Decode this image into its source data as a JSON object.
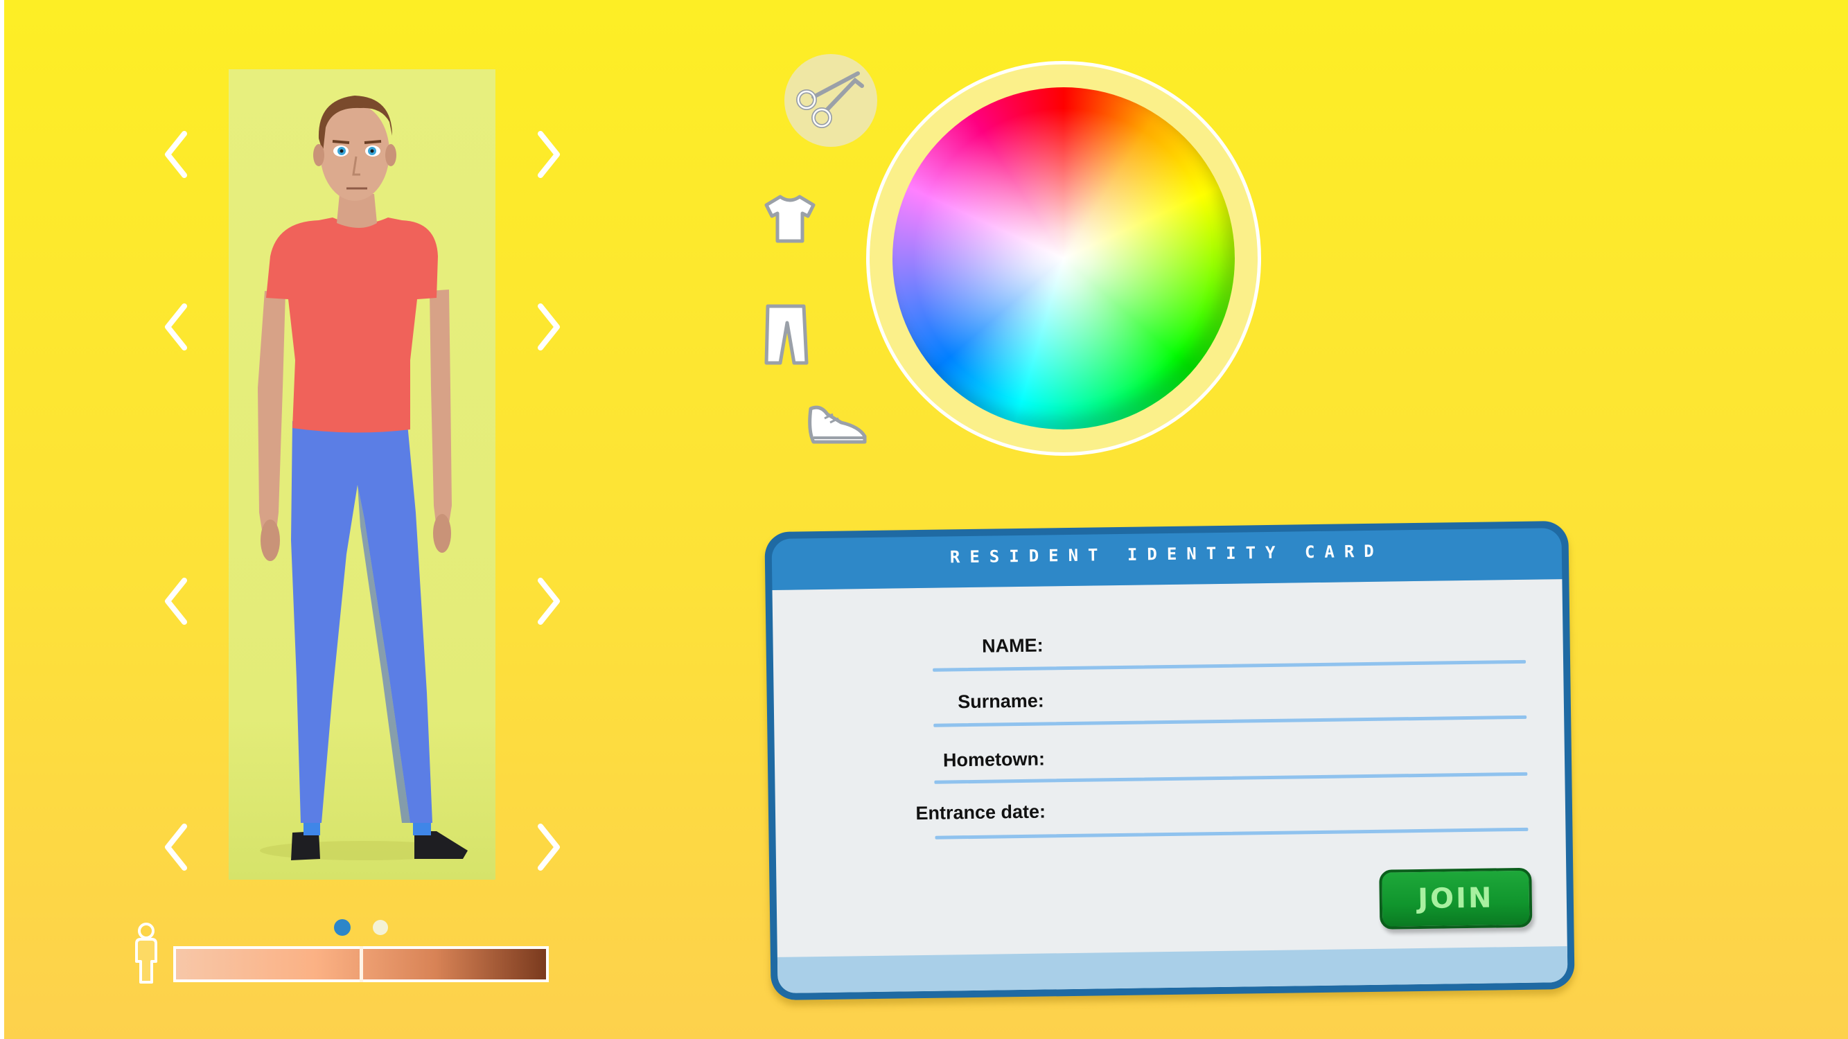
{
  "card": {
    "title": "RESIDENT IDENTITY CARD",
    "fields": [
      {
        "label": "NAME:",
        "value": ""
      },
      {
        "label": "Surname:",
        "value": ""
      },
      {
        "label": "Hometown:",
        "value": ""
      },
      {
        "label": "Entrance date:",
        "value": ""
      }
    ],
    "join_label": "JOIN"
  },
  "customization": {
    "categories": [
      "scissors-icon",
      "shirt-icon",
      "pants-icon",
      "sneaker-icon"
    ],
    "active_category": "scissors-icon"
  },
  "skin_tone": {
    "page_indicator": {
      "pages": 2,
      "active": 1
    },
    "slider_value_fraction": 0.5
  },
  "colors": {
    "background_top": "#fdee25",
    "background_bottom": "#fdd14d",
    "card_blue": "#2e88c8",
    "join_green": "#10952d",
    "shirt": "#f0625a",
    "pants": "#5b7ee5"
  }
}
